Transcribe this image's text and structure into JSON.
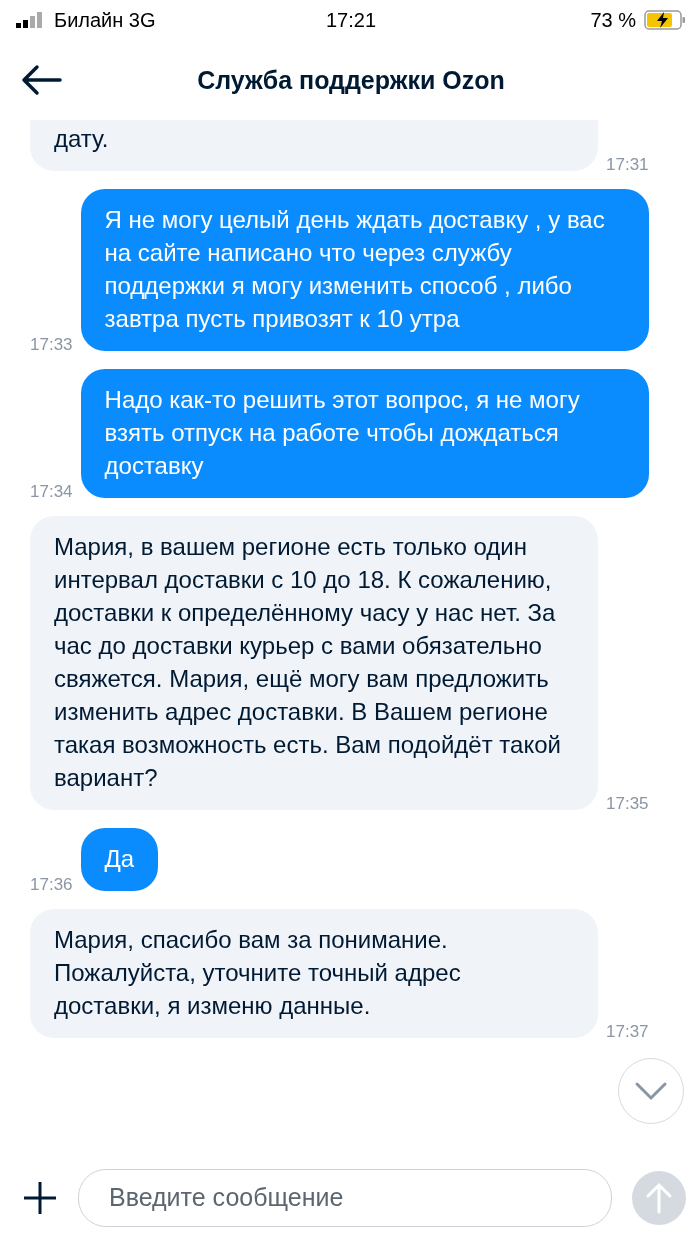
{
  "status_bar": {
    "carrier": "Билайн 3G",
    "time": "17:21",
    "battery": "73 %",
    "charging": true
  },
  "header": {
    "title": "Служба поддержки Ozon"
  },
  "messages": [
    {
      "kind": "incoming",
      "text": "дату.",
      "time": "17:31",
      "cut": true
    },
    {
      "kind": "outgoing",
      "text": "Я не могу целый день ждать доставку , у вас на сайте написано что через службу поддержки я могу изменить способ , либо завтра пусть привозят  к 10 утра",
      "time": "17:33"
    },
    {
      "kind": "outgoing",
      "text": "Надо как-то решить этот вопрос, я не могу взять отпуск на работе чтобы дождаться доставку",
      "time": "17:34"
    },
    {
      "kind": "incoming",
      "text": "Мария, в вашем регионе есть только один интервал доставки с 10 до 18. К сожалению, доставки к определённому часу у нас нет. За час до доставки курьер с вами обязательно свяжется. Мария, ещё могу вам предложить изменить адрес доставки. В Вашем регионе такая возможность есть. Вам подойдёт такой вариант?",
      "time": "17:35"
    },
    {
      "kind": "outgoing",
      "text": "Да",
      "time": "17:36"
    },
    {
      "kind": "incoming",
      "text": "Мария, спасибо вам за понимание. Пожалуйста, уточните точный адрес доставки, я изменю данные.",
      "time": "17:37"
    }
  ],
  "composer": {
    "placeholder": "Введите сообщение"
  }
}
